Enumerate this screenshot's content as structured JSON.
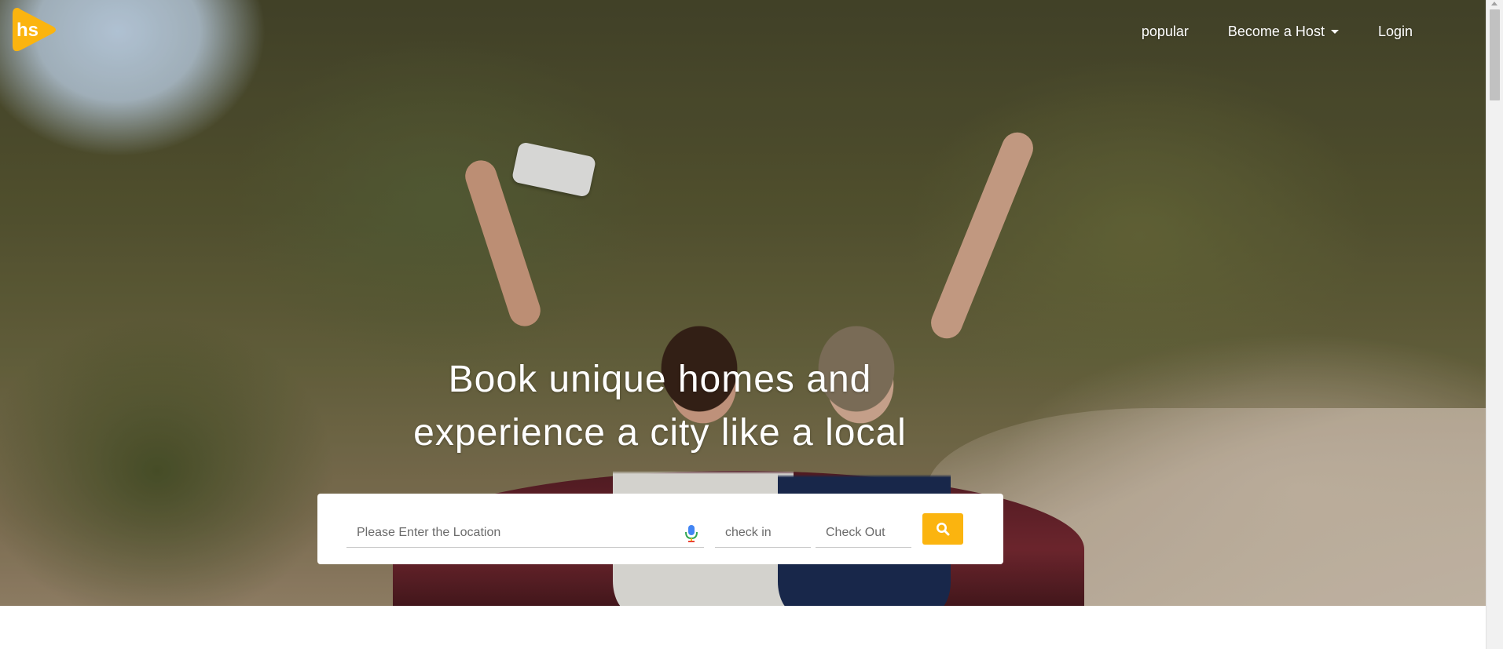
{
  "brand": {
    "logo_text": "hs",
    "logo_color": "#fbb40f"
  },
  "nav": {
    "items": [
      {
        "label": "popular",
        "dropdown": false
      },
      {
        "label": "Become a Host",
        "dropdown": true
      },
      {
        "label": "Login",
        "dropdown": false
      }
    ]
  },
  "hero": {
    "headline_line1": "Book unique homes and",
    "headline_line2": "experience a city like a local"
  },
  "search": {
    "location_placeholder": "Please Enter the Location",
    "checkin_placeholder": "check in",
    "checkout_placeholder": "Check Out",
    "button_icon": "search-icon",
    "button_color": "#fbb40f",
    "mic_icon": "microphone-icon"
  }
}
